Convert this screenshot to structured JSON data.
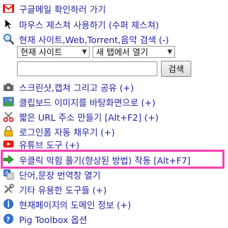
{
  "menu": {
    "items": [
      {
        "label": "구글메일 확인하러 가기",
        "icon": "gmail-icon"
      },
      {
        "label": "마우스 제스쳐 사용하기 (수퍼 제스쳐)",
        "icon": "cursor-icon"
      },
      {
        "label": "현재 사이트,Web,Torrent,음악 검색 (-)",
        "icon": "search-icon"
      },
      {
        "label": "스크린샷,캡쳐 그리고 공유 (+)",
        "icon": "camera-icon"
      },
      {
        "label": "클립보드 이미지를 바탕화면으로 (+)",
        "icon": "clipboard-image-icon"
      },
      {
        "label": "짧은 URL 주소 만들기 [Alt+F2] (+)",
        "icon": "scissors-icon"
      },
      {
        "label": "로그인폼 자동 채우기 (+)",
        "icon": "lock-icon"
      },
      {
        "label": "유튜브 도구 (+)",
        "icon": "youtube-icon"
      },
      {
        "label": "우클릭 막힘 풀기(향상된 방법) 작동 [Alt+F7]",
        "icon": "arrow-right-icon"
      },
      {
        "label": "단어,문장 번역창 열기",
        "icon": "translate-icon"
      },
      {
        "label": "기타 유용한 도구들 (+)",
        "icon": "tools-icon"
      },
      {
        "label": "현재페이지의 도메인 정보 (+)",
        "icon": "info-icon"
      },
      {
        "label": "Pig Toolbox 옵션",
        "icon": "help-icon"
      }
    ]
  },
  "search": {
    "scope_selected": "현재 사이트",
    "target_selected": "새 탭에서 열기",
    "query_value": "",
    "button_label": "검색"
  },
  "colors": {
    "text": "#1f1f9f",
    "highlight": "#ff3fb0"
  }
}
